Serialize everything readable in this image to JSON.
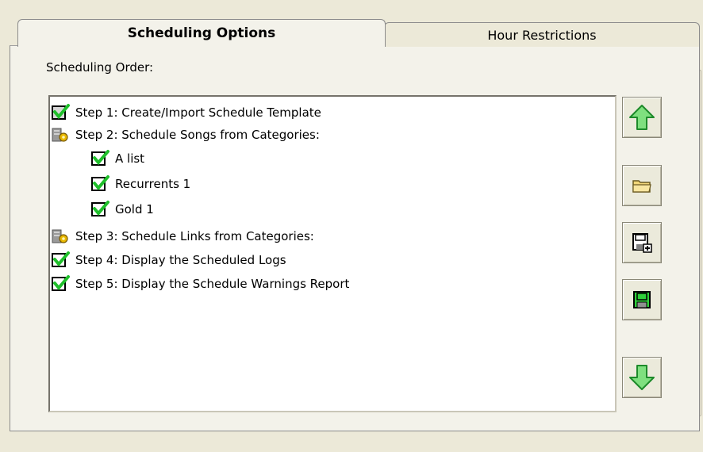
{
  "tabs": {
    "active_label": "Scheduling Options",
    "inactive_label": "Hour Restrictions"
  },
  "group": {
    "label": "Scheduling Order:"
  },
  "steps": [
    {
      "label": "Step 1: Create/Import Schedule Template",
      "icon": "checkbox-checked-icon"
    },
    {
      "label": "Step 2: Schedule Songs from Categories:",
      "icon": "gear-icon"
    },
    {
      "label": "A list",
      "icon": "checkbox-checked-icon"
    },
    {
      "label": "Recurrents 1",
      "icon": "checkbox-checked-icon"
    },
    {
      "label": "Gold 1",
      "icon": "checkbox-checked-icon"
    },
    {
      "label": "Step 3: Schedule Links from Categories:",
      "icon": "gear-icon"
    },
    {
      "label": "Step 4: Display the Scheduled Logs",
      "icon": "checkbox-checked-icon"
    },
    {
      "label": "Step 5: Display the Schedule Warnings Report",
      "icon": "checkbox-checked-icon"
    }
  ],
  "buttons": [
    {
      "icon": "arrow-up-icon"
    },
    {
      "icon": "folder-icon"
    },
    {
      "icon": "save-as-icon"
    },
    {
      "icon": "save-icon"
    },
    {
      "icon": "arrow-down-icon"
    }
  ],
  "colors": {
    "window_bg": "#ece9d8",
    "panel_bg": "#f3f2ea",
    "check_green": "#1fbf2b",
    "arrow_green": "#2fb83a"
  }
}
